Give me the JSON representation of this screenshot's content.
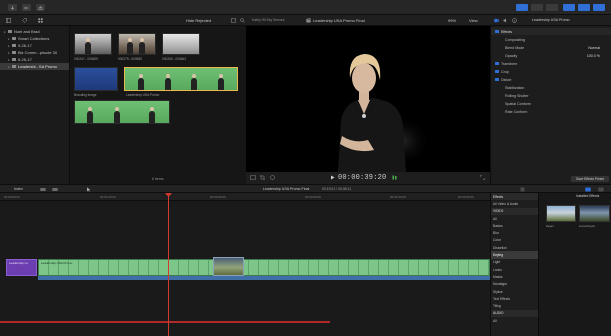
{
  "toolbar": {
    "buttons": [
      "import",
      "keyword",
      "share",
      "library-toggle",
      "photos",
      "titles",
      "browser-toggle",
      "timeline-toggle",
      "inspector-toggle"
    ]
  },
  "browser_header": {
    "filter": "Hide Rejected",
    "clip_title": "Kathy Hil Sky Scenes",
    "project": "Leadership USA Promo Final",
    "zoom": "99%",
    "view": "View",
    "inspector_title": "Leadership USA Promo"
  },
  "sidebar": {
    "items": [
      {
        "label": "Noel and Brad",
        "selected": false,
        "indent": 0
      },
      {
        "label": "Smart Collections",
        "selected": false,
        "indent": 1
      },
      {
        "label": "9-26-17",
        "selected": false,
        "indent": 1
      },
      {
        "label": "Biz Comm...pisode 30",
        "selected": false,
        "indent": 1
      },
      {
        "label": "8-25-17",
        "selected": false,
        "indent": 1
      },
      {
        "label": "Leadershi...SA Promo",
        "selected": true,
        "indent": 1
      }
    ]
  },
  "browser": {
    "clips": [
      {
        "label": "000247...000629"
      },
      {
        "label": "000279...000659"
      },
      {
        "label": "000263...000663"
      },
      {
        "label": "Branding Image"
      },
      {
        "label": "Leadership USA Promo"
      }
    ],
    "footer": "6 items"
  },
  "viewer": {
    "timecode": "00:00:39:20"
  },
  "inspector": {
    "rows": [
      {
        "label": "Effects",
        "value": "",
        "type": "section"
      },
      {
        "label": "Compositing",
        "value": "",
        "type": "plain"
      },
      {
        "label": "Blend Mode",
        "value": "Normal",
        "type": "plain"
      },
      {
        "label": "Opacity",
        "value": "100.0 %",
        "type": "plain"
      },
      {
        "label": "Transform",
        "value": "",
        "type": "check"
      },
      {
        "label": "Crop",
        "value": "",
        "type": "check"
      },
      {
        "label": "Distort",
        "value": "",
        "type": "check"
      },
      {
        "label": "Stabilization",
        "value": "",
        "type": "plain"
      },
      {
        "label": "Rolling Shutter",
        "value": "",
        "type": "plain"
      },
      {
        "label": "Spatial Conform",
        "value": "",
        "type": "plain"
      },
      {
        "label": "Rate Conform",
        "value": "",
        "type": "plain"
      }
    ],
    "save_preset": "Save Effects Preset"
  },
  "timeline_toolbar": {
    "index": "Index",
    "project": "Leadership USA Promo Final",
    "duration": "00:19:21 / 00:08:11"
  },
  "timeline": {
    "ruler": [
      "00:00:00:00",
      "00:00:10:00",
      "00:00:20:00",
      "00:00:30:00",
      "00:00:40:00",
      "00:00:50:00"
    ],
    "title_clip": "Leadership Lo",
    "main_clip": "Leadership USA Promo"
  },
  "effects": {
    "header": "Effects",
    "installed": "Installed Effects",
    "categories": [
      {
        "label": "All Video & Audio",
        "type": "plain"
      },
      {
        "label": "VIDEO",
        "type": "header"
      },
      {
        "label": "All",
        "type": "plain"
      },
      {
        "label": "Basics",
        "type": "plain"
      },
      {
        "label": "Blur",
        "type": "plain"
      },
      {
        "label": "Color",
        "type": "plain"
      },
      {
        "label": "Distortion",
        "type": "plain"
      },
      {
        "label": "Keying",
        "type": "sel"
      },
      {
        "label": "Light",
        "type": "plain"
      },
      {
        "label": "Looks",
        "type": "plain"
      },
      {
        "label": "Masks",
        "type": "plain"
      },
      {
        "label": "Nostalgia",
        "type": "plain"
      },
      {
        "label": "Stylize",
        "type": "plain"
      },
      {
        "label": "Text Effects",
        "type": "plain"
      },
      {
        "label": "Tiling",
        "type": "plain"
      },
      {
        "label": "AUDIO",
        "type": "header"
      },
      {
        "label": "All",
        "type": "plain"
      }
    ],
    "thumbs": [
      {
        "label": "Keyer"
      },
      {
        "label": "Luma Keyer"
      }
    ]
  }
}
